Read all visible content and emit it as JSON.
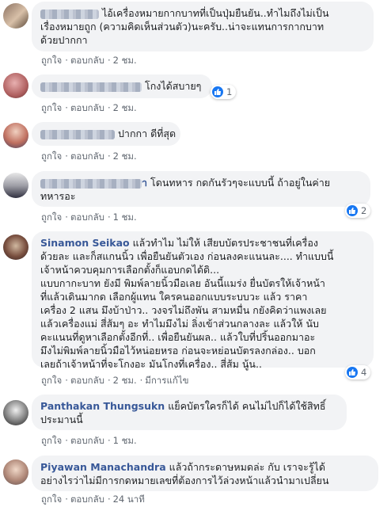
{
  "comments": [
    {
      "lines": [
        "ไอ้เครื่องหมายกากบาทที่เป็นปุ่มยืนยัน..ทำไมถึงไม่เป็น",
        "เรื่องหมายถูก (ความคิดเห็นส่วนตัว)นะครับ..น่าจะแทนการกากบาท",
        "ด้วยปากกา"
      ],
      "like": "ถูกใจ",
      "reply": "ตอบกลับ",
      "time": "2 ชม."
    },
    {
      "text": "โกงได้สบายๆ",
      "like": "ถูกใจ",
      "reply": "ตอบกลับ",
      "time": "2 ชม.",
      "reactions": "1"
    },
    {
      "text": "ปากกา ดีที่สุด",
      "like": "ถูกใจ",
      "reply": "ตอบกลับ",
      "time": "2 ชม."
    },
    {
      "name_tail": "า",
      "lines": [
        "โดนทหาร กดกันรัวๆจะแบบนี้ ถ้าอยู่ในค่าย",
        "ทหารอะ"
      ],
      "like": "ถูกใจ",
      "reply": "ตอบกลับ",
      "time": "1 ชม.",
      "reactions": "2"
    },
    {
      "name": "Sinamon Seikao",
      "lines": [
        "แล้วทำไม ไม่ให้ เสียบบัตรประชาชนที่เครื่อง",
        "ด้วยละ และก็สแกนนิ้ว เพื่อยืนยันตัวเอง ก่อนลงคะแนนละ.... ทำแบบนี้",
        "เจ้าหน้าควบคุมการเลือกตั้งก็แอบกดได้ดิ...",
        "แบบกากะบาท ยังมี พิมพ์ลายนิ้วมือเลย อันนี้แมร่ง ยื่นบัตรให้เจ้าหน้า",
        "ที่แล้วเดินมากด เลือกผู้แทน ใครคนออกแบบระบบวะ แล้ว ราคา",
        "เครื่อง 2 แสน มึงบ้าป่าว.. วงจรไม่ถึงพัน สามหมื่น กยังคิดว่าแพงเลย",
        "แล้วเครื่องแม่ สี่ส้มๆ อะ ทำไมมึงไม่ ลิ่งเข้าส่วนกลางละ แล้วให้ นับ",
        "คะแนนที่ดูหาเลือกตั้งอีกที่.. เพื่อยืนยันผล.. แล้วใบที่ปริ้นออกมาอะ",
        "มึงไม่พิมพ์ลายนิ้วมือไว้หน่อยหรอ ก่อนจะหย่อนบัตรลงกล่อง.. บอก",
        "เลยถ้าเจ้าหน้าที่จะโกงอะ มันโกงที่เครื่อง.. สี่ส้ม นู้น.."
      ],
      "like": "ถูกใจ",
      "reply": "ตอบกลับ",
      "time": "2 ชม.",
      "edited": "มีการแก้ไข",
      "reactions": "4"
    },
    {
      "name": "Panthakan Thungsukn",
      "lines": [
        "แย็คบัตรใครก็ได้ คนไม่ไปก็ได้ใช้สิทธิ์",
        "ประมานนี้"
      ],
      "like": "ถูกใจ",
      "reply": "ตอบกลับ",
      "time": "1 ชม."
    },
    {
      "name": "Piyawan Manachandra",
      "lines": [
        "แล้วถ้ากระดาษหมดล่ะ กับ เราจะรู้ได้",
        "อย่างไรว่าไม่มีการกดหมายเลขที่ต้องการไว้ล่วงหน้าแล้วนำมาเปลี่ยน"
      ],
      "like": "ถูกใจ",
      "reply": "ตอบกลับ",
      "time": "24 นาที"
    }
  ],
  "colors": {
    "bubble": "#f2f3f5",
    "name": "#385898",
    "meta": "#606770",
    "like_blue": "#1877f2"
  },
  "icons": {
    "reaction": "like-thumb-icon"
  }
}
